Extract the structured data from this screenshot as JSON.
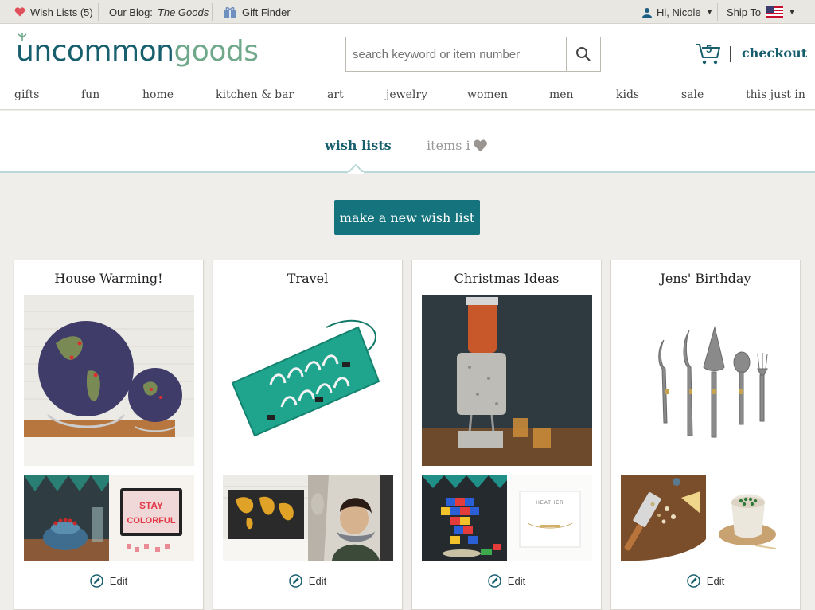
{
  "utility": {
    "wishlists_label": "Wish Lists (5)",
    "blog_label": "Our Blog:",
    "blog_name": "The Goods",
    "giftfinder_label": "Gift Finder",
    "user_label": "Hi, Nicole",
    "shipto_label": "Ship To"
  },
  "header": {
    "logo_part1": "uncommon",
    "logo_part2": "goods",
    "search_placeholder": "search keyword or item number",
    "cart_count": "5",
    "checkout_label": "checkout"
  },
  "nav": [
    "gifts",
    "fun",
    "home",
    "kitchen & bar",
    "art",
    "jewelry",
    "women",
    "men",
    "kids",
    "sale",
    "this just in"
  ],
  "tabs": {
    "active": "wish lists",
    "inactive": "items i"
  },
  "main": {
    "new_list_button": "make a new wish list"
  },
  "cards": [
    {
      "title": "House Warming!",
      "edit": "Edit"
    },
    {
      "title": "Travel",
      "edit": "Edit"
    },
    {
      "title": "Christmas Ideas",
      "edit": "Edit"
    },
    {
      "title": "Jens' Birthday",
      "edit": "Edit"
    }
  ],
  "thumb_text": {
    "lightbox_line1": "STAY",
    "lightbox_line2": "COLORFUL",
    "necklace_name": "HEATHER"
  },
  "colors": {
    "accent": "#14737c",
    "brand_dark": "#185f6e",
    "brand_light": "#6fa88a",
    "heart": "#e0505b"
  }
}
